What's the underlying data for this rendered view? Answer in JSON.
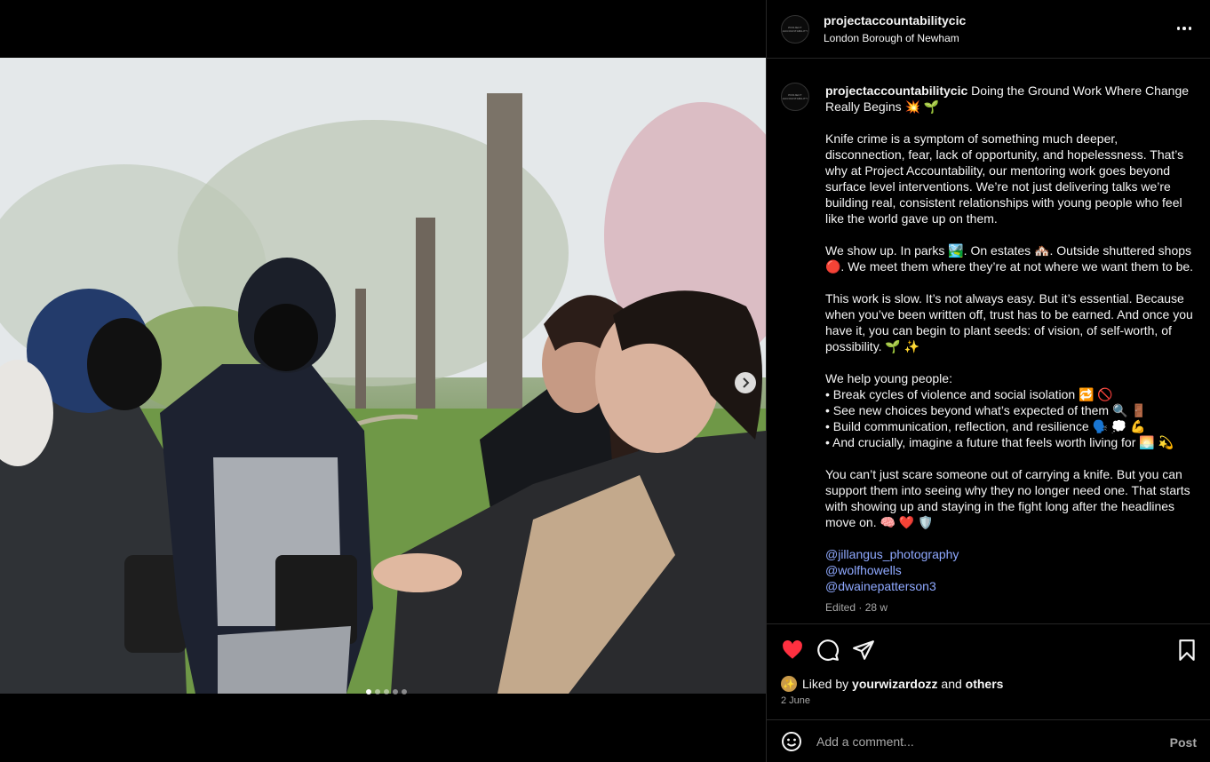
{
  "post": {
    "username": "projectaccountabilitycic",
    "location": "London Borough of Newham",
    "avatar_text": "PROJECT ACCOUNTABILITY",
    "caption_title": "Doing the Ground Work Where Change Really Begins 💥 🌱",
    "paragraphs": [
      "Knife crime is a symptom of something much deeper, disconnection, fear, lack of opportunity, and hopelessness. That’s why at Project Accountability, our mentoring work goes beyond surface level interventions. We’re not just delivering talks we’re building real, consistent relationships with young people who feel like the world gave up on them.",
      "We show up. In parks 🏞️. On estates 🏘️. Outside shuttered shops 🔴. We meet them where they’re at not where we want them to be.",
      "This work is slow. It’s not always easy. But it’s essential. Because when you’ve been written off, trust has to be earned. And once you have it, you can begin to plant seeds: of vision, of self-worth, of possibility. 🌱 ✨",
      "We help young people:\n• Break cycles of violence and social isolation 🔁 🚫\n• See new choices beyond what’s expected of them 🔍 🚪\n• Build communication, reflection, and resilience 🗣️ 💭 💪\n• And crucially, imagine a future that feels worth living for 🌅 💫",
      "You can’t just scare someone out of carrying a knife. But you can support them into seeing why they no longer need one. That starts with showing up and staying in the fight long after the headlines move on. 🧠 ❤️ 🛡️"
    ],
    "mentions": [
      "@jillangus_photography",
      "@wolfhowells",
      "@dwainepatterson3"
    ],
    "edited_label": "Edited · 28 w"
  },
  "engagement": {
    "liked_prefix": "Liked by",
    "liked_user": "yourwizardozz",
    "liked_and": "and",
    "liked_others": "others",
    "date": "2 June"
  },
  "comment": {
    "placeholder": "Add a comment...",
    "post_label": "Post"
  },
  "carousel": {
    "total": 5,
    "current": 1
  },
  "colors": {
    "like_red": "#ff3040",
    "mention_blue": "#8fa9ff",
    "panel_bg": "#000000"
  }
}
